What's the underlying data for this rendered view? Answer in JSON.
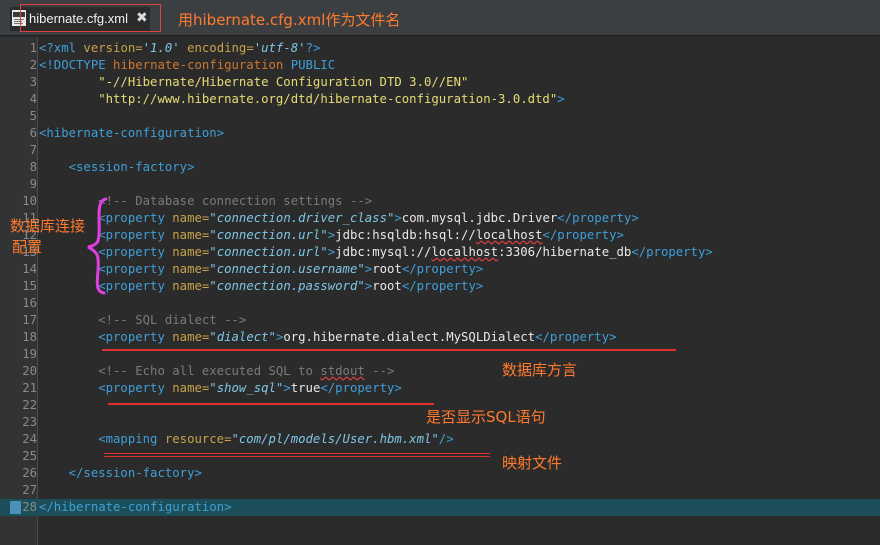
{
  "tab": {
    "label": "hibernate.cfg.xml",
    "close": "✖"
  },
  "annotations": {
    "filename_note": "用hibernate.cfg.xml作为文件名",
    "db_connection_note_line1": "数据库连接",
    "db_connection_note_line2": "配置",
    "dialect_note": "数据库方言",
    "show_sql_note": "是否显示SQL语句",
    "mapping_note": "映射文件"
  },
  "editor": {
    "current_line": 28,
    "lines": [
      {
        "n": "1",
        "segs": [
          [
            "t",
            "<?xml "
          ],
          [
            "an",
            "version="
          ],
          [
            "av",
            "'1.0'"
          ],
          [
            "an",
            " encoding="
          ],
          [
            "av",
            "'utf-8'"
          ],
          [
            "t",
            "?>"
          ]
        ]
      },
      {
        "n": "2",
        "segs": [
          [
            "t",
            "<!DOCTYPE "
          ],
          [
            "kw",
            "hibernate-configuration "
          ],
          [
            "t",
            "PUBLIC"
          ]
        ]
      },
      {
        "n": "3",
        "segs": [
          [
            "dt",
            "        \"-//Hibernate/Hibernate Configuration DTD 3.0//EN\""
          ]
        ]
      },
      {
        "n": "4",
        "segs": [
          [
            "dt",
            "        \"http://www.hibernate.org/dtd/hibernate-configuration-3.0.dtd\""
          ],
          [
            "t",
            ">"
          ]
        ]
      },
      {
        "n": "5",
        "segs": []
      },
      {
        "n": "6",
        "segs": [
          [
            "t",
            "<hibernate-configuration>"
          ]
        ]
      },
      {
        "n": "7",
        "segs": []
      },
      {
        "n": "8",
        "segs": [
          [
            "t",
            "    <session-factory>"
          ]
        ]
      },
      {
        "n": "9",
        "segs": []
      },
      {
        "n": "10",
        "segs": [
          [
            "cm",
            "        <!-- Database connection settings -->"
          ]
        ]
      },
      {
        "n": "11",
        "segs": [
          [
            "t",
            "        <property "
          ],
          [
            "an",
            "name="
          ],
          [
            "av",
            "\"connection.driver_class\""
          ],
          [
            "t",
            ">"
          ],
          [
            "tx",
            "com.mysql.jdbc.Driver"
          ],
          [
            "t",
            "</property>"
          ]
        ]
      },
      {
        "n": "12",
        "segs": [
          [
            "t",
            "        <property "
          ],
          [
            "an",
            "name="
          ],
          [
            "av",
            "\"connection.url\""
          ],
          [
            "t",
            ">"
          ],
          [
            "tx",
            "jdbc:hsqldb:hsql://"
          ],
          [
            "wv",
            "localhost"
          ],
          [
            "t",
            "</property>"
          ]
        ]
      },
      {
        "n": "13",
        "segs": [
          [
            "t",
            "        <property "
          ],
          [
            "an",
            "name="
          ],
          [
            "av",
            "\"connection.url\""
          ],
          [
            "t",
            ">"
          ],
          [
            "tx",
            "jdbc:mysql://"
          ],
          [
            "wv",
            "localhost"
          ],
          [
            "tx",
            ":3306/hibernate_db"
          ],
          [
            "t",
            "</property>"
          ]
        ]
      },
      {
        "n": "14",
        "segs": [
          [
            "t",
            "        <property "
          ],
          [
            "an",
            "name="
          ],
          [
            "av",
            "\"connection.username\""
          ],
          [
            "t",
            ">"
          ],
          [
            "tx",
            "root"
          ],
          [
            "t",
            "</property>"
          ]
        ]
      },
      {
        "n": "15",
        "segs": [
          [
            "t",
            "        <property "
          ],
          [
            "an",
            "name="
          ],
          [
            "av",
            "\"connection.password\""
          ],
          [
            "t",
            ">"
          ],
          [
            "tx",
            "root"
          ],
          [
            "t",
            "</property>"
          ]
        ]
      },
      {
        "n": "16",
        "segs": []
      },
      {
        "n": "17",
        "segs": [
          [
            "cm",
            "        <!-- SQL dialect -->"
          ]
        ]
      },
      {
        "n": "18",
        "segs": [
          [
            "t",
            "        <property "
          ],
          [
            "an",
            "name="
          ],
          [
            "av",
            "\"dialect\""
          ],
          [
            "t",
            ">"
          ],
          [
            "tx",
            "org.hibernate.dialect.MySQLDialect"
          ],
          [
            "t",
            "</property>"
          ]
        ]
      },
      {
        "n": "19",
        "segs": []
      },
      {
        "n": "20",
        "segs": [
          [
            "cm",
            "        <!-- Echo all executed SQL to "
          ],
          [
            "cw",
            "stdout"
          ],
          [
            "cm",
            " -->"
          ]
        ]
      },
      {
        "n": "21",
        "segs": [
          [
            "t",
            "        <property "
          ],
          [
            "an",
            "name="
          ],
          [
            "av",
            "\"show_sql\""
          ],
          [
            "t",
            ">"
          ],
          [
            "tx",
            "true"
          ],
          [
            "t",
            "</property>"
          ]
        ]
      },
      {
        "n": "22",
        "segs": []
      },
      {
        "n": "23",
        "segs": []
      },
      {
        "n": "24",
        "segs": [
          [
            "t",
            "        <mapping "
          ],
          [
            "an",
            "resource="
          ],
          [
            "av",
            "\"com/pl/models/User.hbm.xml\""
          ],
          [
            "t",
            "/>"
          ]
        ]
      },
      {
        "n": "25",
        "segs": []
      },
      {
        "n": "26",
        "segs": [
          [
            "t",
            "    </session-factory>"
          ]
        ]
      },
      {
        "n": "27",
        "segs": []
      },
      {
        "n": "28",
        "segs": [
          [
            "t",
            "</hibernate-configuration>"
          ]
        ]
      }
    ]
  }
}
